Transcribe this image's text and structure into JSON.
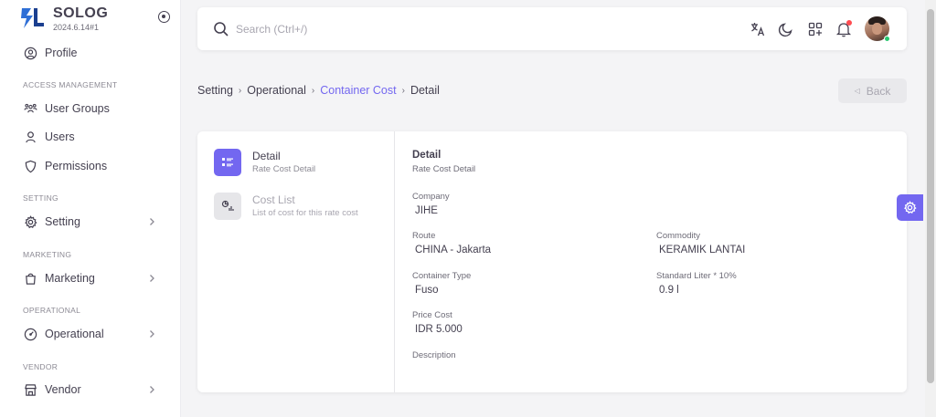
{
  "brand": {
    "name": "SOLOG",
    "version": "2024.6.14#1"
  },
  "sidebar": {
    "profile": "Profile",
    "sections": {
      "access": "ACCESS MANAGEMENT",
      "setting": "SETTING",
      "marketing": "MARKETING",
      "operational": "OPERATIONAL",
      "vendor": "VENDOR"
    },
    "items": {
      "user_groups": "User Groups",
      "users": "Users",
      "permissions": "Permissions",
      "setting": "Setting",
      "marketing": "Marketing",
      "operational": "Operational",
      "vendor": "Vendor"
    }
  },
  "search": {
    "placeholder": "Search (Ctrl+/)"
  },
  "breadcrumb": {
    "items": [
      "Setting",
      "Operational",
      "Container Cost",
      "Detail"
    ]
  },
  "back_label": "Back",
  "steps": [
    {
      "title": "Detail",
      "subtitle": "Rate Cost Detail"
    },
    {
      "title": "Cost List",
      "subtitle": "List of cost for this rate cost"
    }
  ],
  "detail": {
    "title": "Detail",
    "subtitle": "Rate Cost Detail",
    "fields": {
      "company": {
        "label": "Company",
        "value": "JIHE"
      },
      "route": {
        "label": "Route",
        "value": "CHINA - Jakarta"
      },
      "commodity": {
        "label": "Commodity",
        "value": "KERAMIK LANTAI"
      },
      "container_type": {
        "label": "Container Type",
        "value": "Fuso"
      },
      "standard_liter": {
        "label": "Standard Liter * 10%",
        "value": "0.9 l"
      },
      "price_cost": {
        "label": "Price Cost",
        "value": "IDR 5.000"
      },
      "description": {
        "label": "Description",
        "value": ""
      }
    }
  },
  "colors": {
    "primary": "#7367f0",
    "text": "#444050",
    "muted": "#6d6b77",
    "danger": "#ff4c51",
    "success": "#28c76f"
  }
}
